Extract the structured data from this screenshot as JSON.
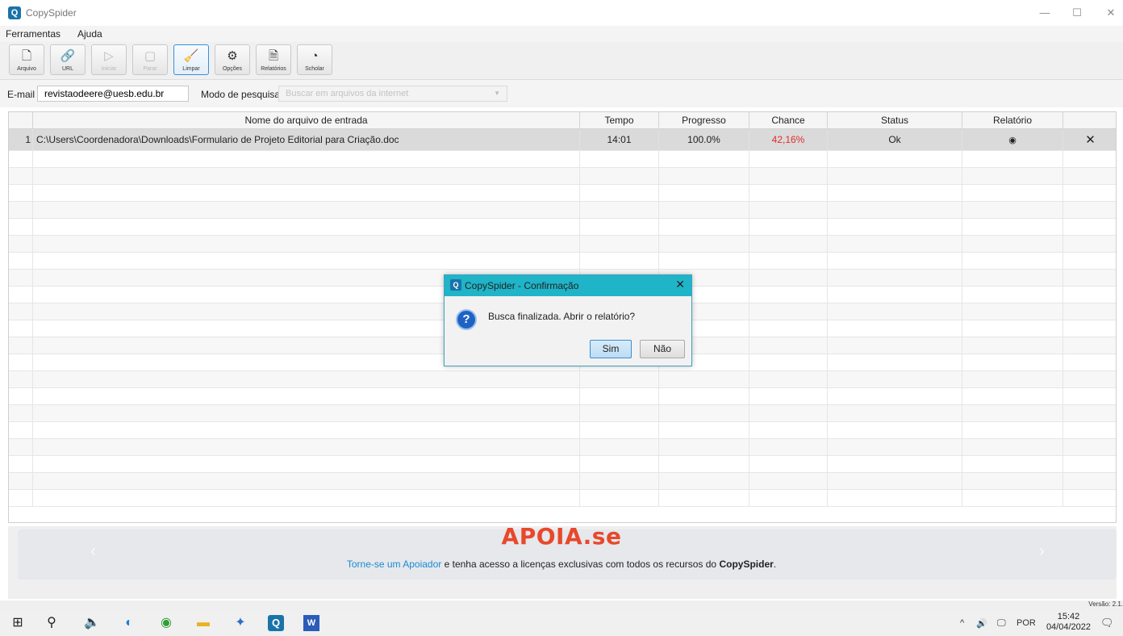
{
  "window": {
    "title": "CopySpider",
    "min": "—",
    "max": "☐",
    "close": "✕",
    "logo_glyph": "Q"
  },
  "menu": [
    "Ferramentas",
    "Ajuda"
  ],
  "toolbar": {
    "buttons": [
      {
        "label": "Arquivo",
        "icon": "file-add-icon",
        "glyph": "🗋",
        "disabled": false,
        "active": false
      },
      {
        "label": "URL",
        "icon": "link-icon",
        "glyph": "🔗",
        "disabled": false,
        "active": false
      },
      {
        "label": "Iniciar",
        "icon": "play-icon",
        "glyph": "▷",
        "disabled": true,
        "active": false
      },
      {
        "label": "Parar",
        "icon": "stop-icon",
        "glyph": "▢",
        "disabled": true,
        "active": false
      },
      {
        "label": "Limpar",
        "icon": "broom-icon",
        "glyph": "🧹",
        "disabled": false,
        "active": true
      },
      {
        "label": "Opções",
        "icon": "gear-icon",
        "glyph": "⚙",
        "disabled": false,
        "active": false
      },
      {
        "label": "Relatórios",
        "icon": "report-icon",
        "glyph": "🗎",
        "disabled": false,
        "active": false
      },
      {
        "label": "Scholar",
        "icon": "pie-chart-icon",
        "glyph": "◔",
        "disabled": false,
        "active": false
      }
    ]
  },
  "form": {
    "email_label": "E-mail",
    "email_value": "revistaodeere@uesb.edu.br",
    "mode_label": "Modo de pesquisa",
    "mode_value": "Buscar em arquivos da internet"
  },
  "table": {
    "columns": [
      "",
      "Nome do arquivo de entrada",
      "Tempo",
      "Progresso",
      "Chance",
      "Status",
      "Relatório",
      ""
    ],
    "rows": [
      {
        "num": "1",
        "file": "C:\\Users\\Coordenadora\\Downloads\\Formulario de Projeto Editorial para Criação.doc",
        "tempo": "14:01",
        "progresso": "100.0%",
        "chance": "42,16%",
        "status": "Ok",
        "relatorio_icon": "◉",
        "remove": "✕"
      }
    ]
  },
  "banner": {
    "logo": "APOIA.se",
    "link_text": "Torne-se um Apoiador",
    "text_middle": " e tenha acesso a licenças exclusivas com todos os recursos do ",
    "brand": "CopySpider",
    "text_end": ".",
    "prev": "‹",
    "next": "›"
  },
  "version": "Versão: 2.1.",
  "dialog": {
    "title": "CopySpider - Confirmação",
    "message": "Busca finalizada. Abrir o relatório?",
    "yes": "Sim",
    "no": "Não",
    "close": "✕",
    "question_glyph": "?"
  },
  "taskbar": {
    "icons": [
      {
        "name": "windows-start-icon",
        "glyph": "⊞"
      },
      {
        "name": "search-icon",
        "glyph": "⚲"
      },
      {
        "name": "speaker-app-icon",
        "glyph": "🔈"
      },
      {
        "name": "edge-browser-icon",
        "glyph": "◐"
      },
      {
        "name": "chrome-browser-icon",
        "glyph": "◉"
      },
      {
        "name": "file-explorer-icon",
        "glyph": "▬"
      },
      {
        "name": "network-app-icon",
        "glyph": "✦"
      },
      {
        "name": "copyspider-app-icon",
        "glyph": "Q"
      },
      {
        "name": "word-app-icon",
        "glyph": "W"
      }
    ],
    "tray_chevron": "^",
    "tray_volume": "🔊",
    "tray_network": "🖵",
    "lang": "POR",
    "time": "15:42",
    "date": "04/04/2022",
    "notifications": "🗨"
  }
}
